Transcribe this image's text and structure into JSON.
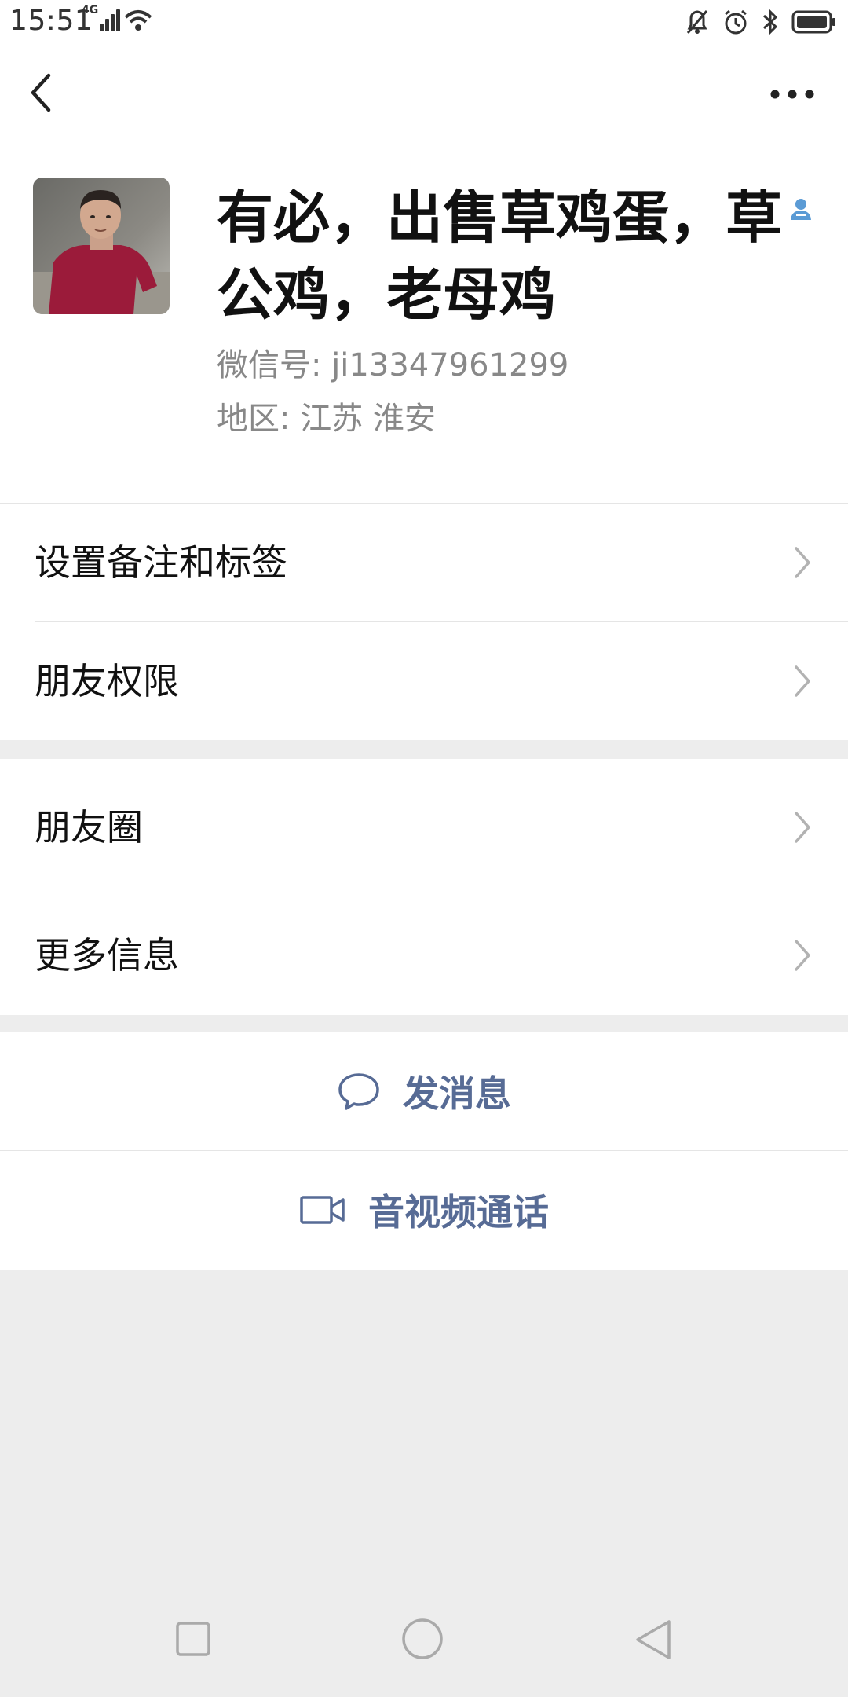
{
  "status_bar": {
    "time": "15:51",
    "network": "4G",
    "icons": [
      "signal-icon",
      "wifi-icon",
      "mute-icon",
      "alarm-icon",
      "bluetooth-icon",
      "battery-icon"
    ]
  },
  "header": {
    "back_icon": "back-arrow-icon",
    "more_icon": "more-dots-icon"
  },
  "profile": {
    "name": "有必，出售草鸡蛋，草公鸡，老母鸡",
    "wechat_id": "微信号: ji13347961299",
    "region": "地区: 江苏  淮安",
    "tag_icon": "contact-tag-icon"
  },
  "section1": {
    "items": [
      {
        "label": "设置备注和标签"
      },
      {
        "label": "朋友权限"
      }
    ]
  },
  "section2": {
    "items": [
      {
        "label": "朋友圈"
      },
      {
        "label": "更多信息"
      }
    ]
  },
  "actions": {
    "message_label": "发消息",
    "call_label": "音视频通话"
  },
  "navbar": {
    "icons": [
      "recent-apps-icon",
      "home-icon",
      "back-icon"
    ]
  },
  "colors": {
    "link": "#576b95",
    "background": "#ededed",
    "divider": "#e5e5e5"
  }
}
